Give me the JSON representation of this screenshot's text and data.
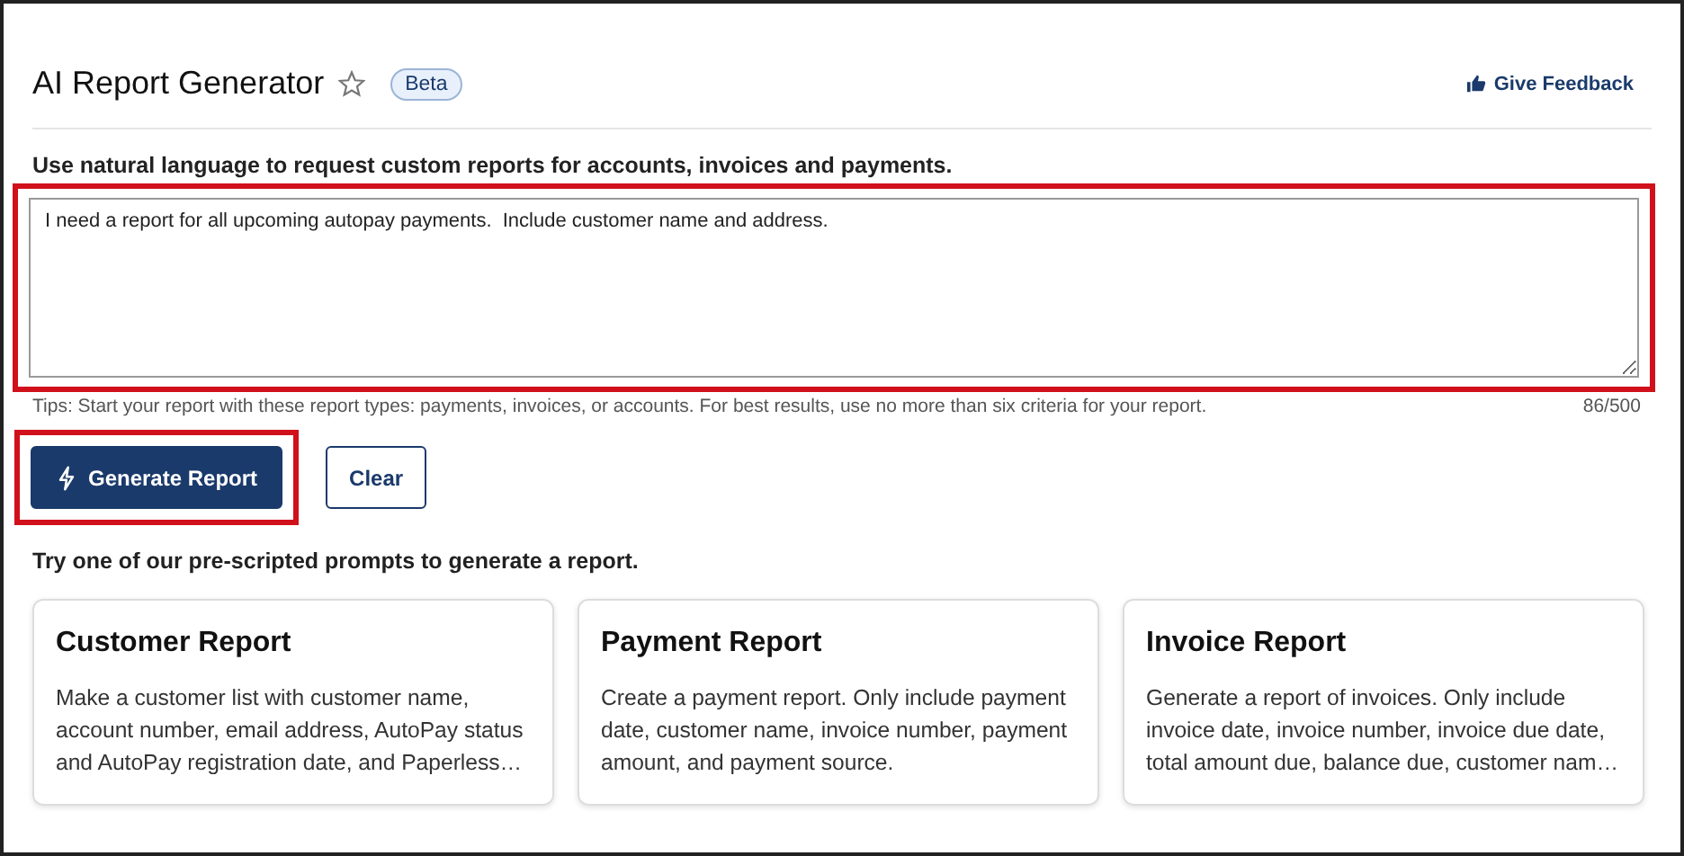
{
  "header": {
    "title": "AI Report Generator",
    "favorite": false,
    "badge": "Beta",
    "feedback_link": "Give Feedback"
  },
  "request": {
    "label": "Use natural language to request custom reports for accounts, invoices and payments.",
    "value": "I need a report for all upcoming autopay payments.  Include customer name and address.",
    "highlighted": true,
    "tips": "Tips: Start your report with these report types: payments, invoices, or accounts. For best results, use no more than six criteria for your report.",
    "counter": "86/500"
  },
  "buttons": [
    {
      "label": "Generate Report",
      "kind": "primary",
      "highlighted": true
    },
    {
      "label": "Clear",
      "kind": "secondary",
      "highlighted": false
    }
  ],
  "prompts": {
    "heading": "Try one of our pre-scripted prompts to generate a report.",
    "cards": [
      {
        "title": "Customer Report",
        "description": "Make a customer list with customer name, account number, email address, AutoPay status and AutoPay registration date, and Paperless…"
      },
      {
        "title": "Payment Report",
        "description": "Create a payment report. Only include payment date, customer name, invoice number, payment amount, and payment source."
      },
      {
        "title": "Invoice Report",
        "description": "Generate a report of invoices. Only include invoice date, invoice number, invoice due date, total amount due, balance due, customer nam…"
      }
    ]
  }
}
